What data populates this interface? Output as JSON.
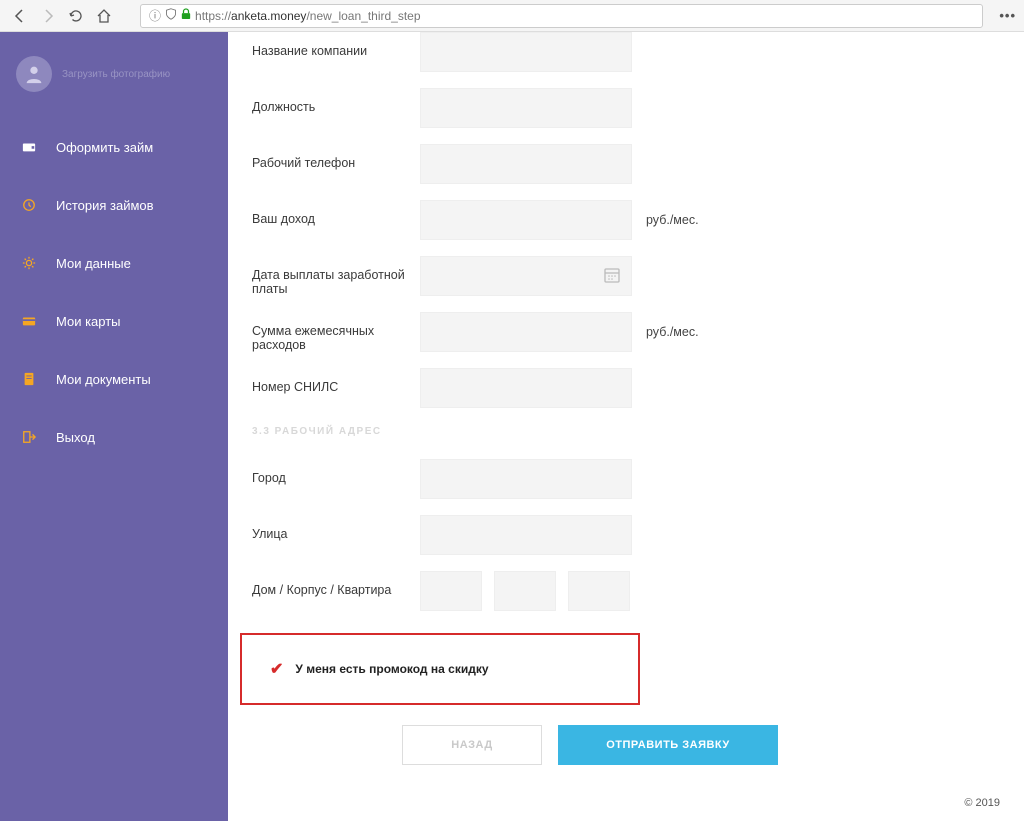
{
  "browser": {
    "url_prefix": "https://",
    "url_host": "anketa.money",
    "url_path": "/new_loan_third_step"
  },
  "sidebar": {
    "upload_text": "Загрузить фотографию",
    "items": [
      {
        "label": "Оформить займ"
      },
      {
        "label": "История займов"
      },
      {
        "label": "Мои данные"
      },
      {
        "label": "Мои карты"
      },
      {
        "label": "Мои документы"
      },
      {
        "label": "Выход"
      }
    ]
  },
  "form": {
    "company_label": "Название компании",
    "position_label": "Должность",
    "work_phone_label": "Рабочий телефон",
    "income_label": "Ваш доход",
    "income_suffix": "руб./мес.",
    "pay_date_label": "Дата выплаты заработной платы",
    "expenses_label": "Сумма ежемесячных расходов",
    "expenses_suffix": "руб./мес.",
    "snils_label": "Номер СНИЛС",
    "section_heading": "3.3 РАБОЧИЙ АДРЕС",
    "city_label": "Город",
    "street_label": "Улица",
    "house_label": "Дом / Корпус / Квартира",
    "promo_text": "У меня есть промокод на скидку"
  },
  "buttons": {
    "back": "НАЗАД",
    "submit": "ОТПРАВИТЬ ЗАЯВКУ"
  },
  "footer": {
    "copyright": "© 2019"
  }
}
